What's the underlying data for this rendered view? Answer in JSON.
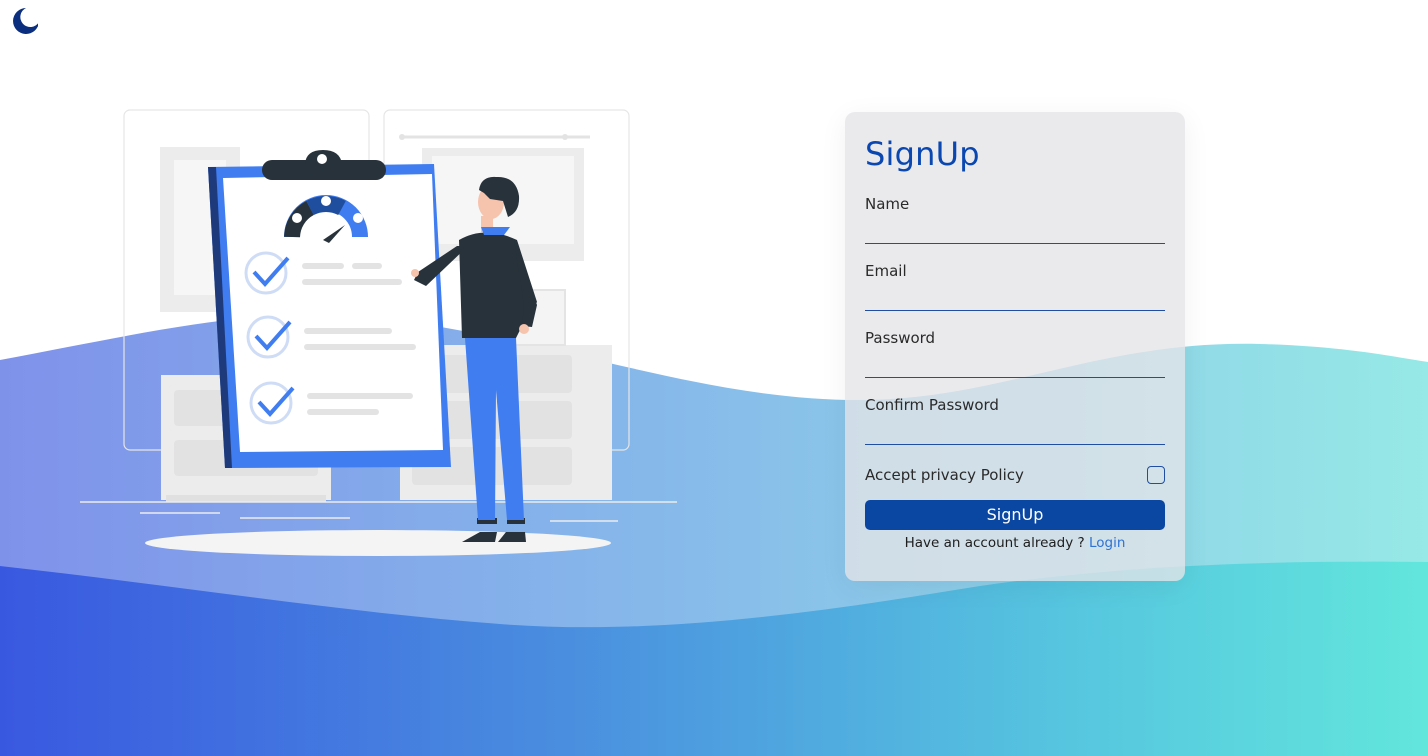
{
  "form": {
    "title": "SignUp",
    "fields": [
      {
        "label": "Name",
        "value": ""
      },
      {
        "label": "Email",
        "value": ""
      },
      {
        "label": "Password",
        "value": ""
      },
      {
        "label": "Confirm Password",
        "value": ""
      }
    ],
    "policy_label": "Accept privacy Policy",
    "policy_checked": false,
    "submit_label": "SignUp",
    "login_prompt": "Have an account already ?",
    "login_link": "Login"
  },
  "icons": {
    "theme_toggle": "moon-icon",
    "illustration": "survey-checklist-illustration"
  },
  "colors": {
    "accent": "#0a47a3",
    "title": "#0a47b0",
    "link": "#2d72d6",
    "wave_left": "#3a5be0",
    "wave_right": "#60e6dd"
  }
}
